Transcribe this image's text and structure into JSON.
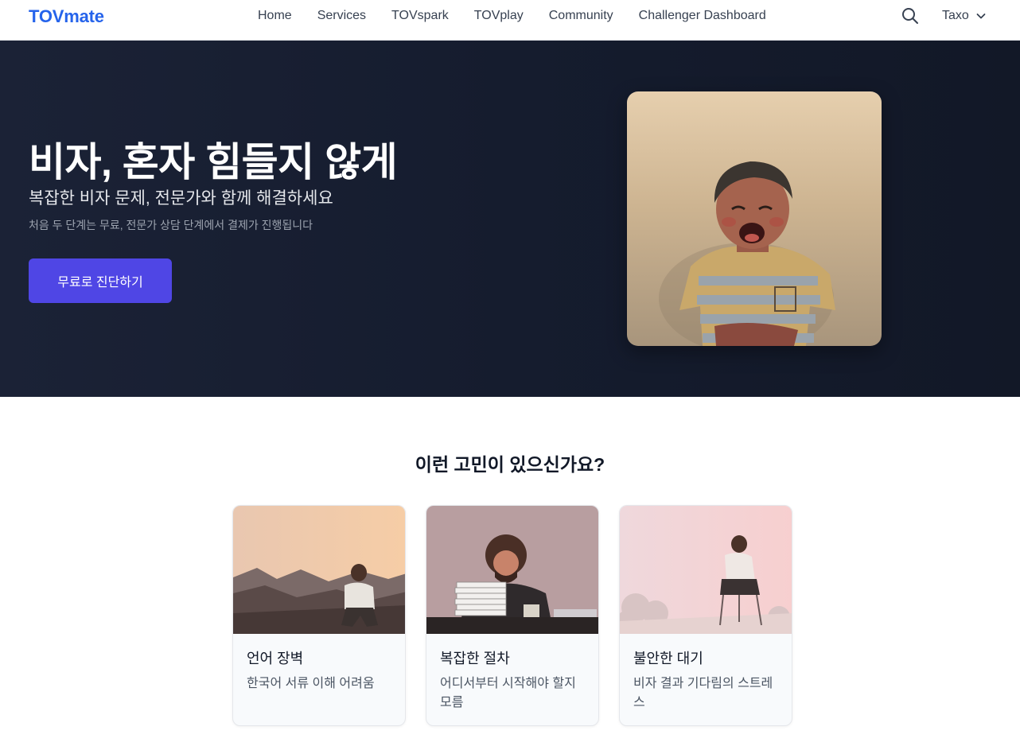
{
  "nav": {
    "logo": "TOVmate",
    "links": [
      "Home",
      "Services",
      "TOVspark",
      "TOVplay",
      "Community",
      "Challenger Dashboard"
    ],
    "search_icon": "search-icon",
    "language": "Taxo",
    "language_icon": "chevron-down-icon"
  },
  "hero": {
    "title": "비자, 혼자 힘들지 않게",
    "subtitle": "복잡한 비자 문제, 전문가와 함께 해결하세요",
    "note": "처음 두 단계는 무료, 전문가 상담 단계에서 결제가 진행됩니다",
    "cta_label": "무료로 진단하기"
  },
  "concerns": {
    "heading": "이런 고민이 있으신가요?",
    "cards": [
      {
        "title": "언어 장벽",
        "description": "한국어 서류 이해 어려움"
      },
      {
        "title": "복잡한 절차",
        "description": "어디서부터 시작해야 할지 모름"
      },
      {
        "title": "불안한 대기",
        "description": "비자 결과 기다림의 스트레스"
      }
    ]
  },
  "colors": {
    "brand": "#2563eb",
    "hero_bg": "#151c2e",
    "cta": "#4f46e5"
  }
}
